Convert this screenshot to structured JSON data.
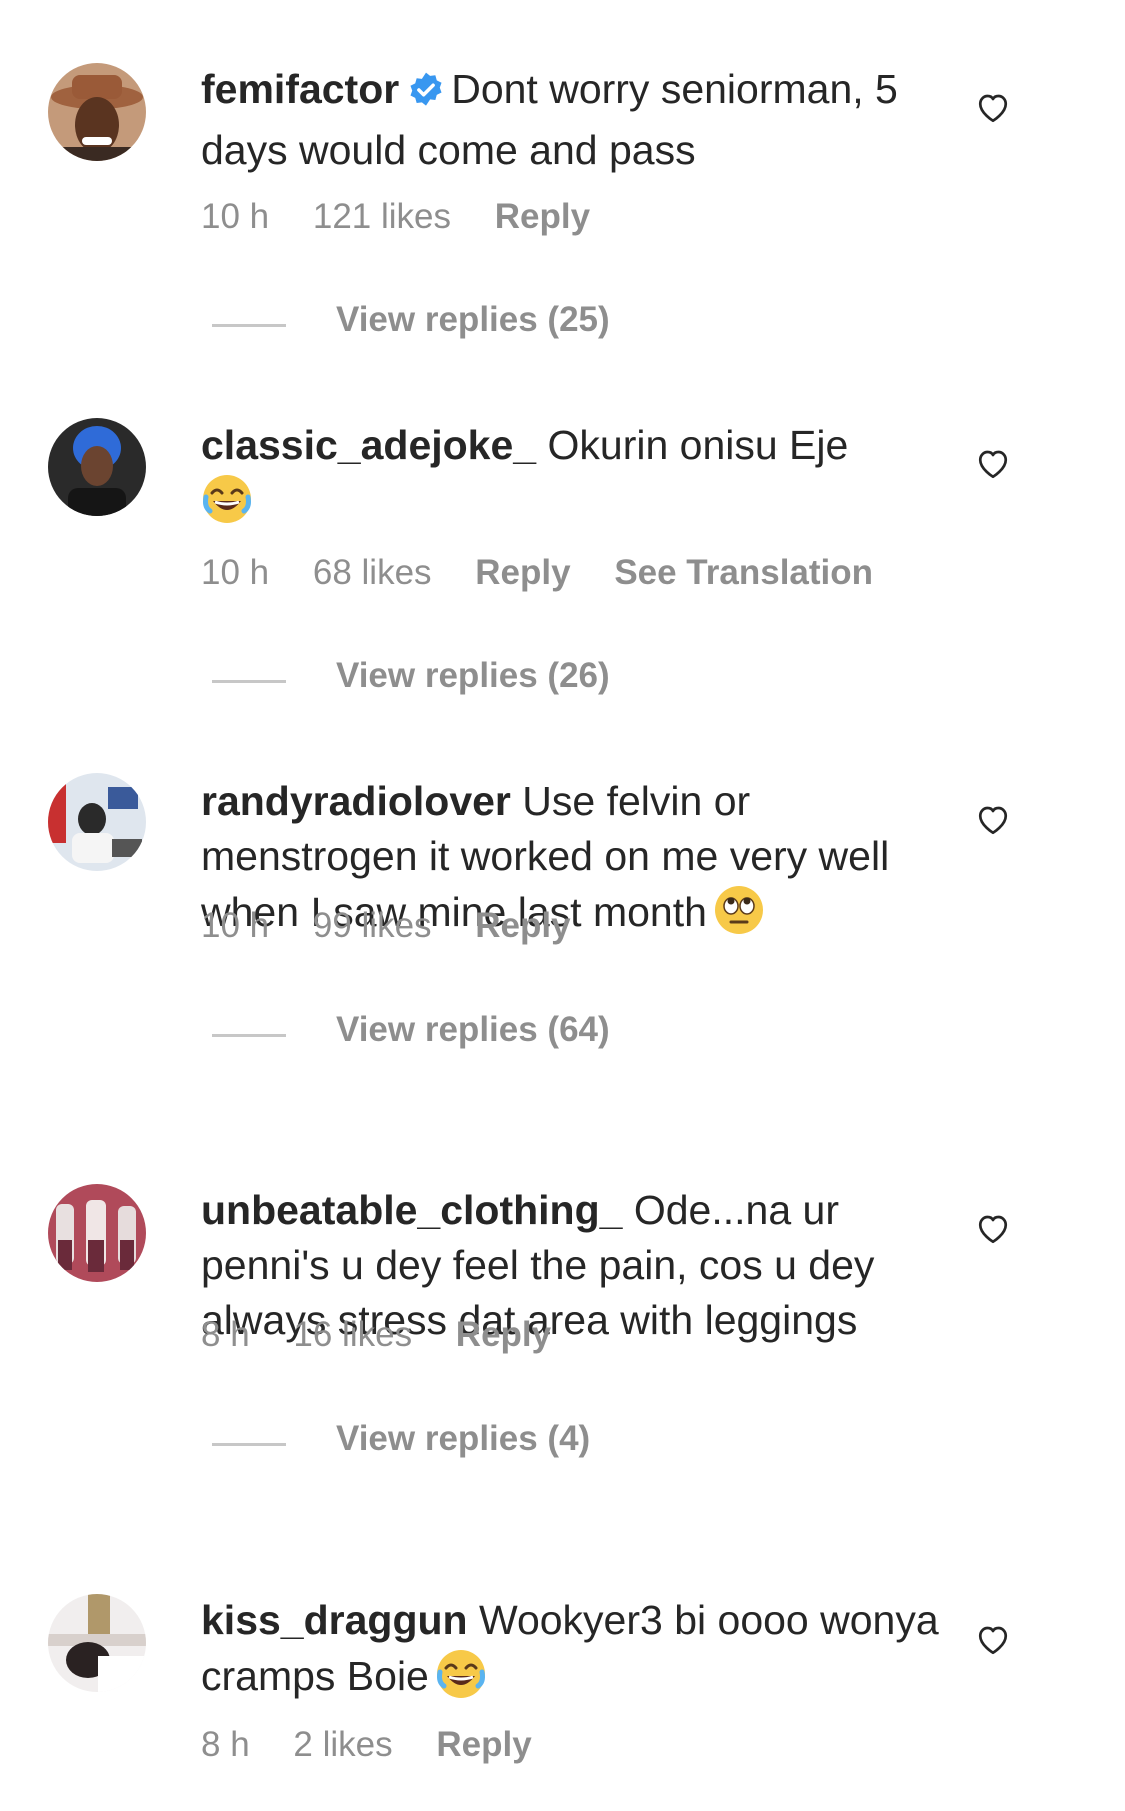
{
  "comments": [
    {
      "username": "femifactor",
      "verified": true,
      "text": "Dont worry seniorman, 5 days would come and pass",
      "time": "10 h",
      "likes": "121 likes",
      "reply": "Reply",
      "translation": "",
      "emoji": "",
      "view_replies": "View replies (25)"
    },
    {
      "username": "classic_adejoke_",
      "verified": false,
      "text": "Okurin onisu Eje",
      "time": "10 h",
      "likes": "68 likes",
      "reply": "Reply",
      "translation": "See Translation",
      "emoji": "joy",
      "view_replies": "View replies (26)"
    },
    {
      "username": "randyradiolover",
      "verified": false,
      "text": "Use felvin or menstrogen it worked on me very well when I saw mine last month",
      "time": "10 h",
      "likes": "99 likes",
      "reply": "Reply",
      "translation": "",
      "emoji": "eye-roll",
      "view_replies": "View replies (64)"
    },
    {
      "username": "unbeatable_clothing_",
      "verified": false,
      "text": "Ode...na ur penni's u dey feel the pain, cos u dey always stress dat area with leggings",
      "time": "8 h",
      "likes": "16 likes",
      "reply": "Reply",
      "translation": "",
      "emoji": "",
      "view_replies": "View replies (4)"
    },
    {
      "username": "kiss_draggun",
      "verified": false,
      "text": "Wookyer3 bi oooo wonya cramps Boie",
      "time": "8 h",
      "likes": "2 likes",
      "reply": "Reply",
      "translation": "",
      "emoji": "joy",
      "view_replies": ""
    }
  ],
  "icons": {
    "heart": "heart-outline-icon",
    "verified": "verified-badge-icon"
  },
  "colors": {
    "text": "#262626",
    "secondary": "#8e8e8e",
    "verified": "#3897f0"
  }
}
